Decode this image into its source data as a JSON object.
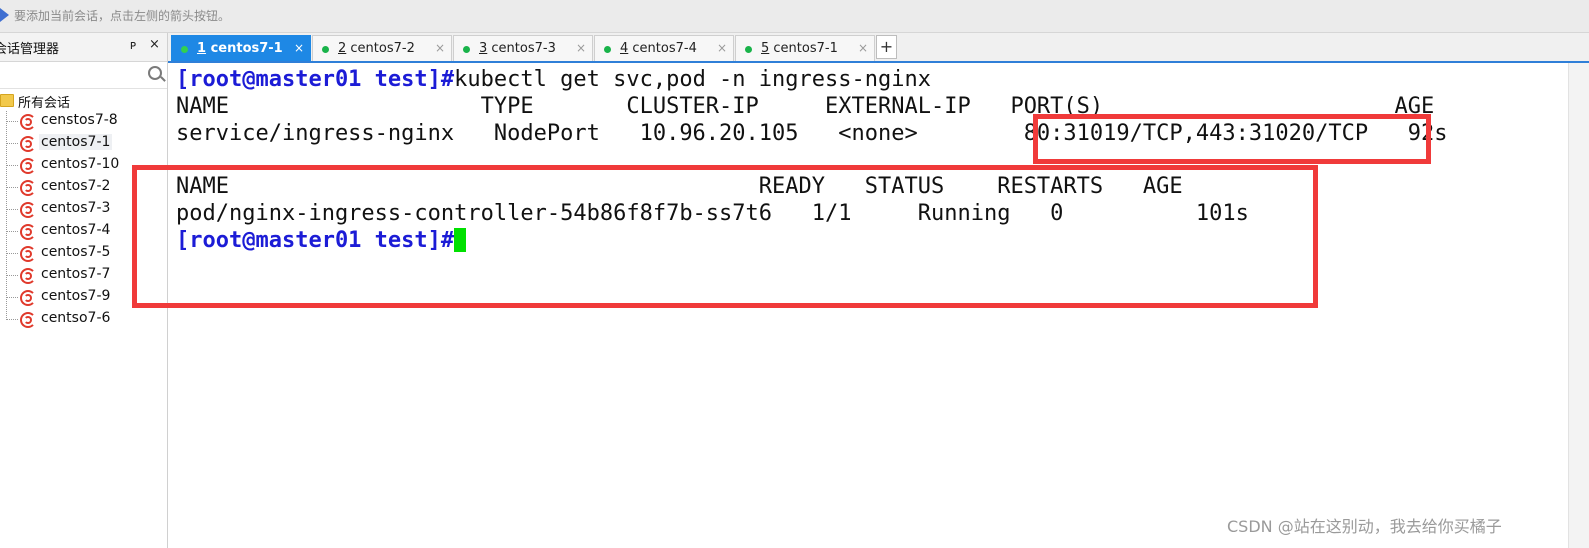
{
  "topbar": {
    "hint": "要添加当前会话，点击左侧的箭头按钮。"
  },
  "sidebar": {
    "title": "会话管理器",
    "pin_glyph": "ᴘ",
    "close_glyph": "×",
    "root_label": "所有会话",
    "sessions": [
      {
        "label": "censtos7-8"
      },
      {
        "label": "centos7-1"
      },
      {
        "label": "centos7-10"
      },
      {
        "label": "centos7-2"
      },
      {
        "label": "centos7-3"
      },
      {
        "label": "centos7-4"
      },
      {
        "label": "centos7-5"
      },
      {
        "label": "centos7-7"
      },
      {
        "label": "centos7-9"
      },
      {
        "label": "centso7-6"
      }
    ]
  },
  "tabs": [
    {
      "num": "1",
      "name": " centos7-1",
      "close": "×"
    },
    {
      "num": "2",
      "name": " centos7-2",
      "close": "×"
    },
    {
      "num": "3",
      "name": " centos7-3",
      "close": "×"
    },
    {
      "num": "4",
      "name": " centos7-4",
      "close": "×"
    },
    {
      "num": "5",
      "name": " centos7-1",
      "close": "×"
    }
  ],
  "tab_add": "+",
  "terminal": {
    "prompt": "[root@master01 test]#",
    "command": "kubectl get svc,pod -n ingress-nginx",
    "svc_header": "NAME                   TYPE       CLUSTER-IP     EXTERNAL-IP   PORT(S)                      AGE",
    "svc_row": "service/ingress-nginx   NodePort   10.96.20.105   <none>        80:31019/TCP,443:31020/TCP   92s",
    "pod_header": "NAME                                        READY   STATUS    RESTARTS   AGE",
    "pod_row": "pod/nginx-ingress-controller-54b86f8f7b-ss7t6   1/1     Running   0          101s",
    "prompt2": "[root@master01 test]#"
  },
  "watermark": "CSDN @站在这别动，我去给你买橘子",
  "colors": {
    "accent": "#1e88e5",
    "highlight_box": "#f03a3a",
    "prompt": "#1c1cd6",
    "cursor": "#00e000"
  }
}
